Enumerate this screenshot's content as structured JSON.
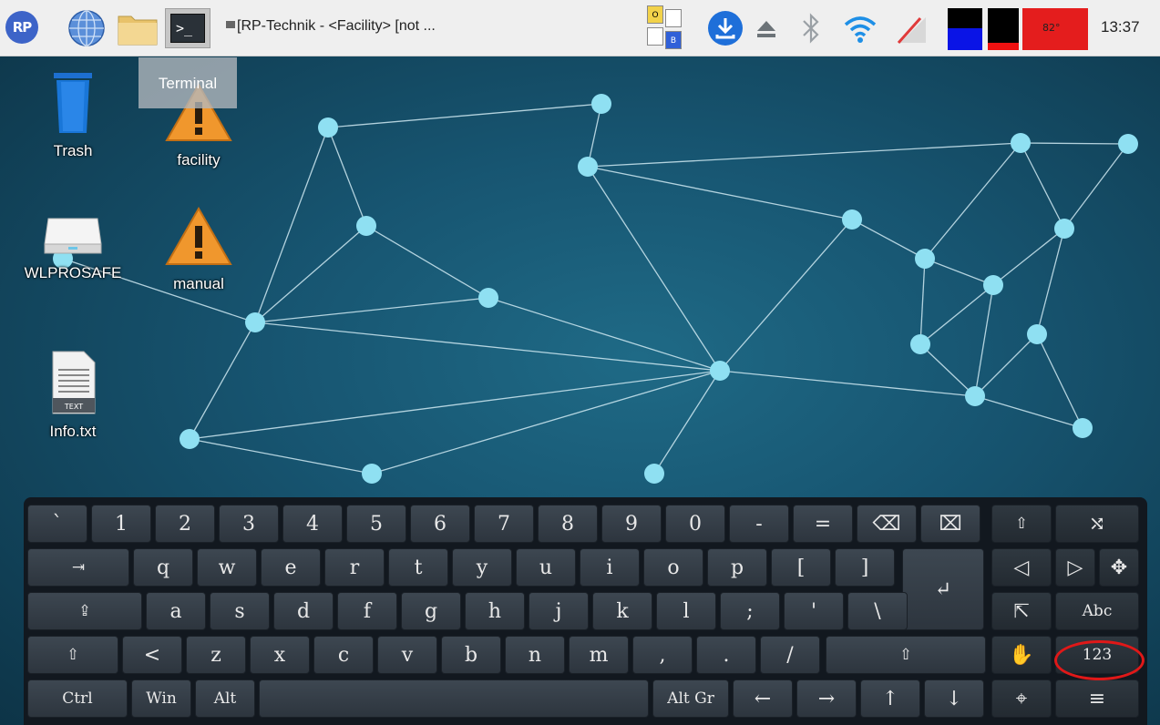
{
  "taskbar": {
    "logo_text": "RP",
    "window_title": "[RP-Technik - <Facility> [not ...",
    "terminal_glyph": ">_",
    "kbd_indicator": {
      "o_label": "O",
      "b_label": "B"
    },
    "temperature": "82°",
    "clock": "13:37",
    "colors": {
      "cpu": "#0a14e6",
      "mem": "#e11111",
      "temp": "#e41d1d"
    }
  },
  "desktop": {
    "tooltip": "Terminal",
    "icons": [
      {
        "label": "Trash",
        "icon": "trash-icon"
      },
      {
        "label": "facility",
        "icon": "warning-icon"
      },
      {
        "label": "WLPROSAFE",
        "icon": "drive-icon"
      },
      {
        "label": "manual",
        "icon": "warning-icon"
      },
      {
        "label": "Info.txt",
        "icon": "text-file-icon",
        "badge": "TEXT"
      }
    ]
  },
  "keyboard": {
    "rows": [
      [
        "`",
        "1",
        "2",
        "3",
        "4",
        "5",
        "6",
        "7",
        "8",
        "9",
        "0",
        "-",
        "=",
        "⌫",
        "⌧",
        "⇧",
        "⤭"
      ],
      [
        "⇥",
        "q",
        "w",
        "e",
        "r",
        "t",
        "y",
        "u",
        "i",
        "o",
        "p",
        "[",
        "]",
        "↵",
        "◁",
        "▷",
        "✥"
      ],
      [
        "⇪",
        "a",
        "s",
        "d",
        "f",
        "g",
        "h",
        "j",
        "k",
        "l",
        ";",
        "'",
        "\\",
        "⇱",
        "Abc"
      ],
      [
        "⇧",
        "<",
        "z",
        "x",
        "c",
        "v",
        "b",
        "n",
        "m",
        ",",
        ".",
        "/",
        "⇧",
        "✋",
        "123"
      ],
      [
        "Ctrl",
        "Win",
        "Alt",
        "",
        "Alt Gr",
        "←",
        "→",
        "↑",
        "↓",
        "⌖",
        "≡"
      ]
    ],
    "highlighted_key": "123"
  }
}
